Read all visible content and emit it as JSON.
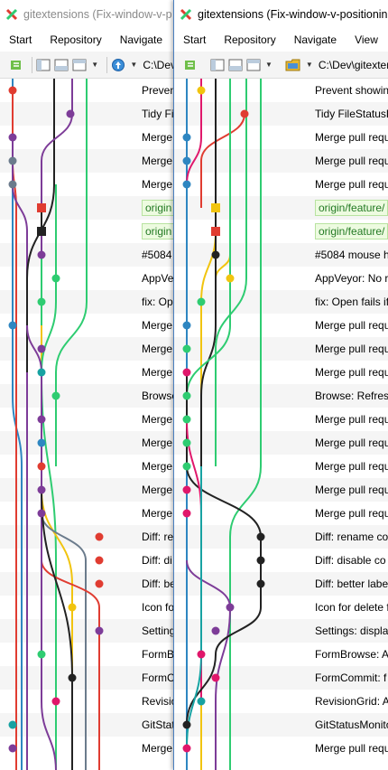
{
  "colors": {
    "blue": "#2e86c1",
    "red": "#e03c31",
    "purple": "#7d3c98",
    "green": "#2ecc71",
    "black": "#222222",
    "gray": "#6b7b8c",
    "yellow": "#f1c40f",
    "pink": "#e0176b",
    "teal": "#17a2a2"
  },
  "left": {
    "title": "gitextensions (Fix-window-v-p",
    "menu": [
      "Start",
      "Repository",
      "Navigate"
    ],
    "path": "C:\\Dev",
    "rows": [
      {
        "text": "Prevent"
      },
      {
        "text": "Tidy Fi"
      },
      {
        "text": "Merge"
      },
      {
        "text": "Merge"
      },
      {
        "text": "Merge"
      },
      {
        "text": "origin",
        "ref": true
      },
      {
        "text": "origin",
        "ref": true
      },
      {
        "text": "#5084"
      },
      {
        "text": "AppVey"
      },
      {
        "text": "fix: Op"
      },
      {
        "text": "Merge"
      },
      {
        "text": "Merge"
      },
      {
        "text": "Merge"
      },
      {
        "text": "Browse"
      },
      {
        "text": "Merge"
      },
      {
        "text": "Merge"
      },
      {
        "text": "Merge"
      },
      {
        "text": "Merge"
      },
      {
        "text": "Merge"
      },
      {
        "text": "Diff: re"
      },
      {
        "text": "Diff: di"
      },
      {
        "text": "Diff: be"
      },
      {
        "text": "Icon fo"
      },
      {
        "text": "Setting"
      },
      {
        "text": "FormB"
      },
      {
        "text": "FormC"
      },
      {
        "text": "Revisio"
      },
      {
        "text": "GitStat"
      },
      {
        "text": "Merge"
      }
    ]
  },
  "right": {
    "title": "gitextensions (Fix-window-v-positioning",
    "menu": [
      "Start",
      "Repository",
      "Navigate",
      "View"
    ],
    "path": "C:\\Dev\\gitexter",
    "rows": [
      {
        "text": "Prevent showin"
      },
      {
        "text": "Tidy FileStatusL"
      },
      {
        "text": "Merge pull requ"
      },
      {
        "text": "Merge pull requ"
      },
      {
        "text": "Merge pull requ"
      },
      {
        "text": "origin/feature/",
        "ref": true
      },
      {
        "text": "origin/feature/",
        "ref": true
      },
      {
        "text": "#5084 mouse h"
      },
      {
        "text": "AppVeyor: No r"
      },
      {
        "text": "fix: Open fails if"
      },
      {
        "text": "Merge pull requ"
      },
      {
        "text": "Merge pull requ"
      },
      {
        "text": "Merge pull requ"
      },
      {
        "text": "Browse: Refresh"
      },
      {
        "text": "Merge pull requ"
      },
      {
        "text": "Merge pull requ"
      },
      {
        "text": "Merge pull requ"
      },
      {
        "text": "Merge pull requ"
      },
      {
        "text": "Merge pull requ"
      },
      {
        "text": "Diff: rename co"
      },
      {
        "text": "Diff: disable co"
      },
      {
        "text": "Diff: better labe"
      },
      {
        "text": "Icon for delete f"
      },
      {
        "text": "Settings: display"
      },
      {
        "text": "FormBrowse: A"
      },
      {
        "text": "FormCommit: f"
      },
      {
        "text": "RevisionGrid: A"
      },
      {
        "text": "GitStatusMonito"
      },
      {
        "text": "Merge pull requ"
      }
    ]
  }
}
